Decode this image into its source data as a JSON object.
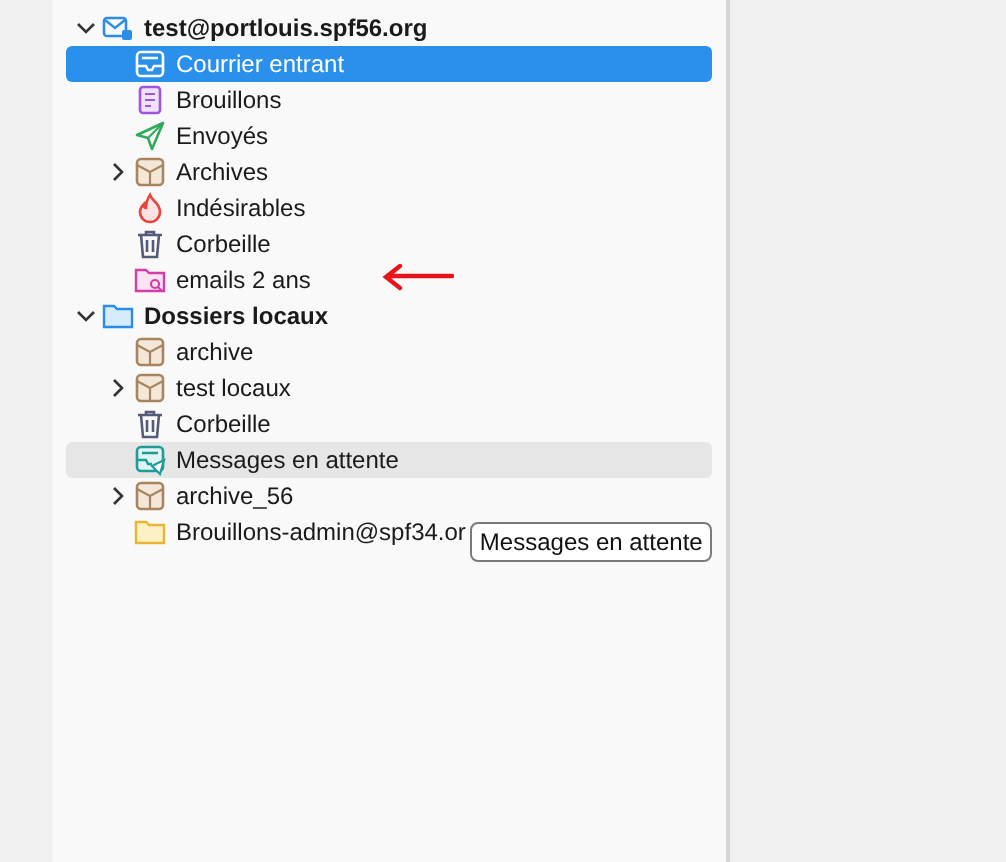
{
  "folder_tree": [
    {
      "name": "test@portlouis.spf56.org",
      "kind": "account",
      "expanded": true,
      "selected": false,
      "hovered": false,
      "children": [
        {
          "name": "Courrier entrant",
          "kind": "inbox",
          "selected": true,
          "hovered": false
        },
        {
          "name": "Brouillons",
          "kind": "drafts",
          "selected": false,
          "hovered": false
        },
        {
          "name": "Envoyés",
          "kind": "sent",
          "selected": false,
          "hovered": false
        },
        {
          "name": "Archives",
          "kind": "archive",
          "expanded": false,
          "selected": false,
          "hovered": false
        },
        {
          "name": "Indésirables",
          "kind": "junk",
          "selected": false,
          "hovered": false
        },
        {
          "name": "Corbeille",
          "kind": "trash",
          "selected": false,
          "hovered": false
        },
        {
          "name": "emails 2 ans",
          "kind": "search",
          "selected": false,
          "hovered": false,
          "annotated": true
        }
      ]
    },
    {
      "name": "Dossiers locaux",
      "kind": "local_folders",
      "expanded": true,
      "selected": false,
      "hovered": false,
      "children": [
        {
          "name": "archive",
          "kind": "archive",
          "selected": false,
          "hovered": false
        },
        {
          "name": "test locaux",
          "kind": "archive",
          "expanded": false,
          "selected": false,
          "hovered": false
        },
        {
          "name": "Corbeille",
          "kind": "trash",
          "selected": false,
          "hovered": false
        },
        {
          "name": "Messages en attente",
          "kind": "outbox",
          "selected": false,
          "hovered": true
        },
        {
          "name": "archive_56",
          "kind": "archive",
          "expanded": false,
          "selected": false,
          "hovered": false
        },
        {
          "name": "Brouillons-admin@spf34.or",
          "kind": "folder",
          "selected": false,
          "hovered": false,
          "tooltip": "Messages en attente"
        }
      ]
    }
  ]
}
